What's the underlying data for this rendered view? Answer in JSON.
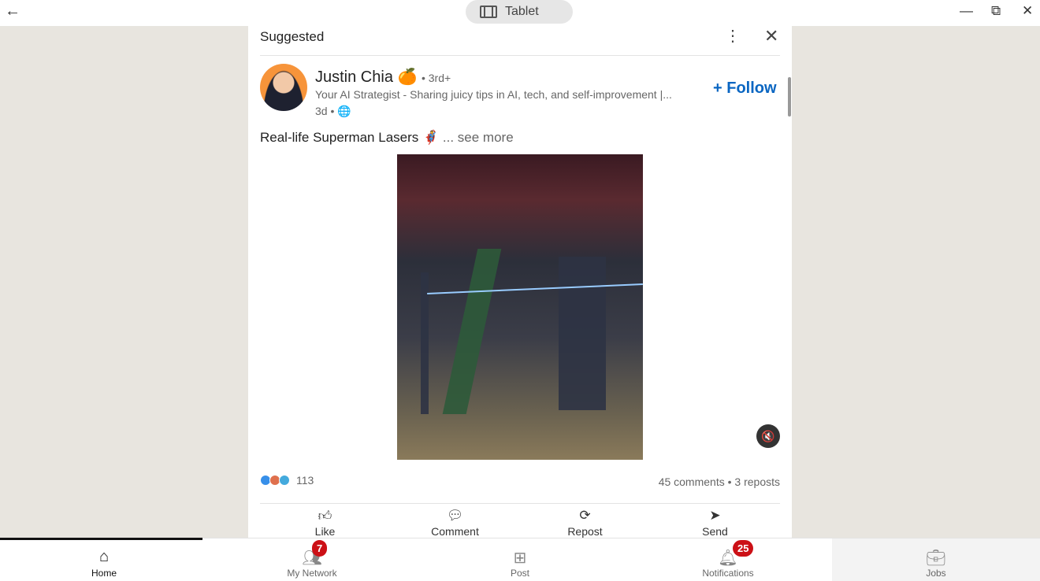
{
  "window": {
    "mode": "Tablet"
  },
  "card": {
    "section": "Suggested"
  },
  "post": {
    "author": "Justin Chia",
    "author_emoji": "🍊",
    "degree": "• 3rd+",
    "headline": "Your AI Strategist - Sharing juicy tips in AI, tech, and self-improvement |...",
    "age": "3d •",
    "follow": "Follow",
    "text": "Real-life Superman Lasers 🦸",
    "see_more": "... see more",
    "reactions": "113",
    "stats": "45 comments • 3 reposts"
  },
  "actions": [
    {
      "label": "Like",
      "icon": "thumbs-up"
    },
    {
      "label": "Comment",
      "icon": "comment"
    },
    {
      "label": "Repost",
      "icon": "repost"
    },
    {
      "label": "Send",
      "icon": "send"
    }
  ],
  "nav": [
    {
      "label": "Home",
      "icon": "home"
    },
    {
      "label": "My Network",
      "icon": "people",
      "badge": "7"
    },
    {
      "label": "Post",
      "icon": "plus-square"
    },
    {
      "label": "Notifications",
      "icon": "bell",
      "badge": "25"
    },
    {
      "label": "Jobs",
      "icon": "briefcase"
    }
  ],
  "colors": {
    "accent": "#0a66c2",
    "badge": "#cc1016"
  }
}
